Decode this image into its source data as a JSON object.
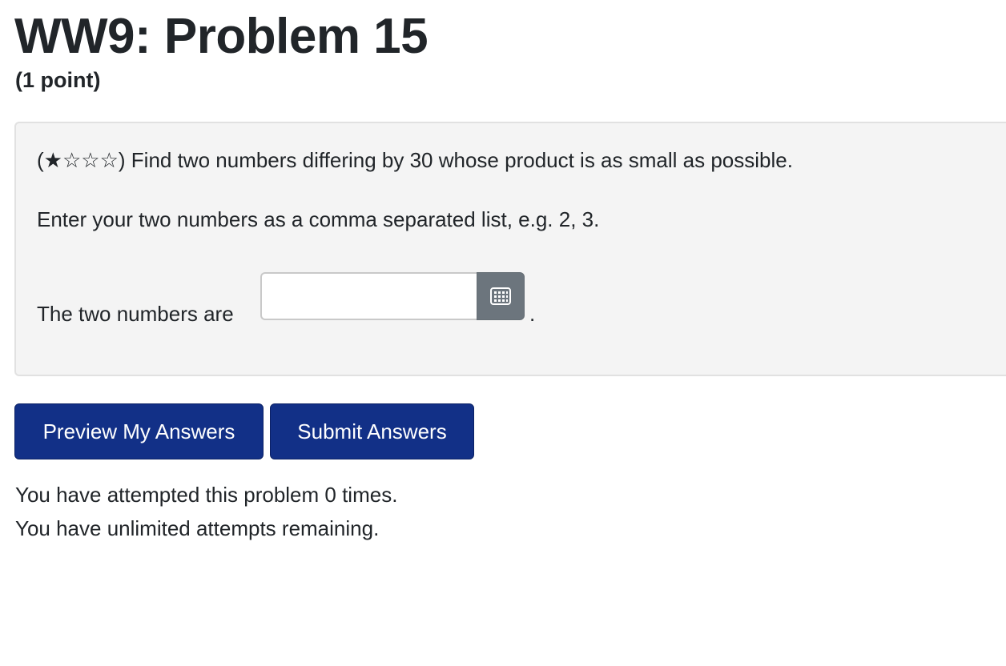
{
  "header": {
    "title": "WW9: Problem 15",
    "points": "(1 point)"
  },
  "problem": {
    "difficulty": "(★☆☆☆)",
    "question": " Find two numbers differing by 30 whose product is as small as possible.",
    "instruction": "Enter your two numbers as a comma separated list, e.g. 2, 3.",
    "answer_label": "The two numbers are",
    "answer_value": "",
    "answer_suffix": ".",
    "equation_editor_icon": "keyboard-grid-icon"
  },
  "actions": {
    "preview_label": "Preview My Answers",
    "submit_label": "Submit Answers"
  },
  "status": {
    "attempts_text": "You have attempted this problem 0 times.",
    "remaining_text": "You have unlimited attempts remaining."
  },
  "colors": {
    "button_bg": "#123087",
    "panel_bg": "#f4f4f4",
    "addon_bg": "#6c757d"
  }
}
